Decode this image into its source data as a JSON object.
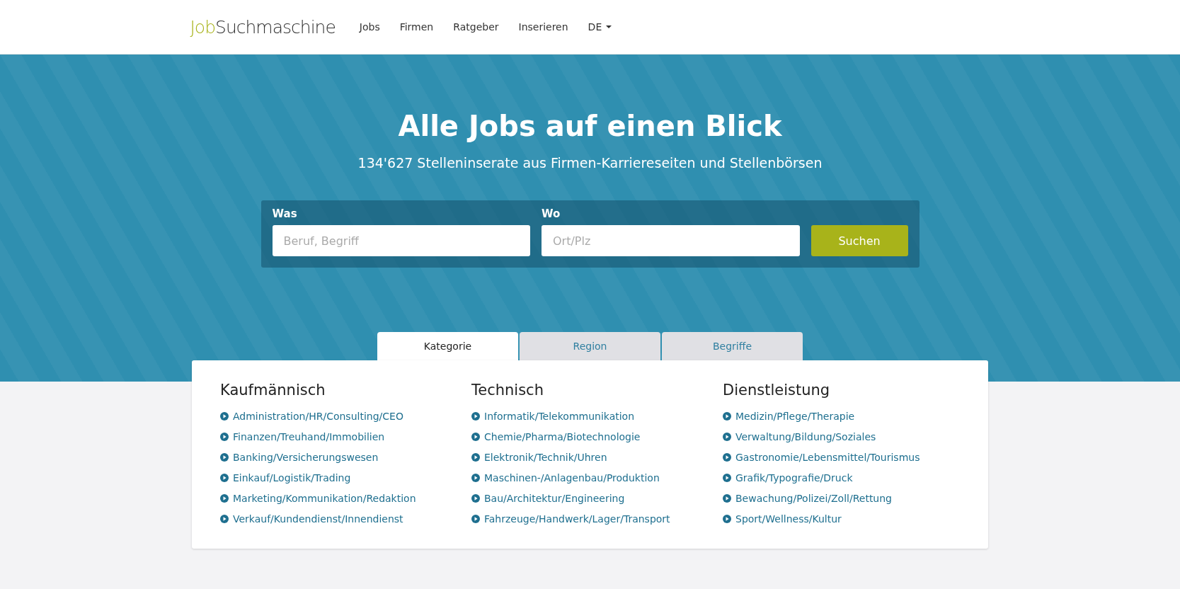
{
  "header": {
    "logo": {
      "part_1": "Job",
      "part_2": "Suchmaschine"
    },
    "nav": [
      {
        "label": "Jobs",
        "kind": "link"
      },
      {
        "label": "Firmen",
        "kind": "link"
      },
      {
        "label": "Ratgeber",
        "kind": "link"
      },
      {
        "label": "Inserieren",
        "kind": "link"
      },
      {
        "label": "DE",
        "kind": "dropdown"
      }
    ]
  },
  "hero": {
    "title": "Alle Jobs auf einen Blick",
    "subtitle": "134'627 Stelleninserate aus Firmen-Karriereseiten und Stellenbörsen"
  },
  "search": {
    "fields": [
      {
        "label": "Was",
        "placeholder": "Beruf, Begriff"
      },
      {
        "label": "Wo",
        "placeholder": "Ort/Plz"
      }
    ],
    "button": "Suchen"
  },
  "tabs": [
    {
      "label": "Kategorie",
      "selected": true
    },
    {
      "label": "Region",
      "selected": false
    },
    {
      "label": "Begriffe",
      "selected": false
    }
  ],
  "categories": [
    {
      "heading": "Kaufmännisch",
      "links": [
        "Administration/HR/Consulting/CEO",
        "Finanzen/Treuhand/Immobilien",
        "Banking/Versicherungswesen",
        "Einkauf/Logistik/Trading",
        "Marketing/Kommunikation/Redaktion",
        "Verkauf/Kundendienst/Innendienst"
      ]
    },
    {
      "heading": "Technisch",
      "links": [
        "Informatik/Telekommunikation",
        "Chemie/Pharma/Biotechnologie",
        "Elektronik/Technik/Uhren",
        "Maschinen-/Anlagenbau/Produktion",
        "Bau/Architektur/Engineering",
        "Fahrzeuge/Handwerk/Lager/Transport"
      ]
    },
    {
      "heading": "Dienstleistung",
      "links": [
        "Medizin/Pflege/Therapie",
        "Verwaltung/Bildung/Soziales",
        "Gastronomie/Lebensmittel/Tourismus",
        "Grafik/Typografie/Druck",
        "Bewachung/Polizei/Zoll/Rettung",
        "Sport/Wellness/Kultur"
      ]
    }
  ]
}
